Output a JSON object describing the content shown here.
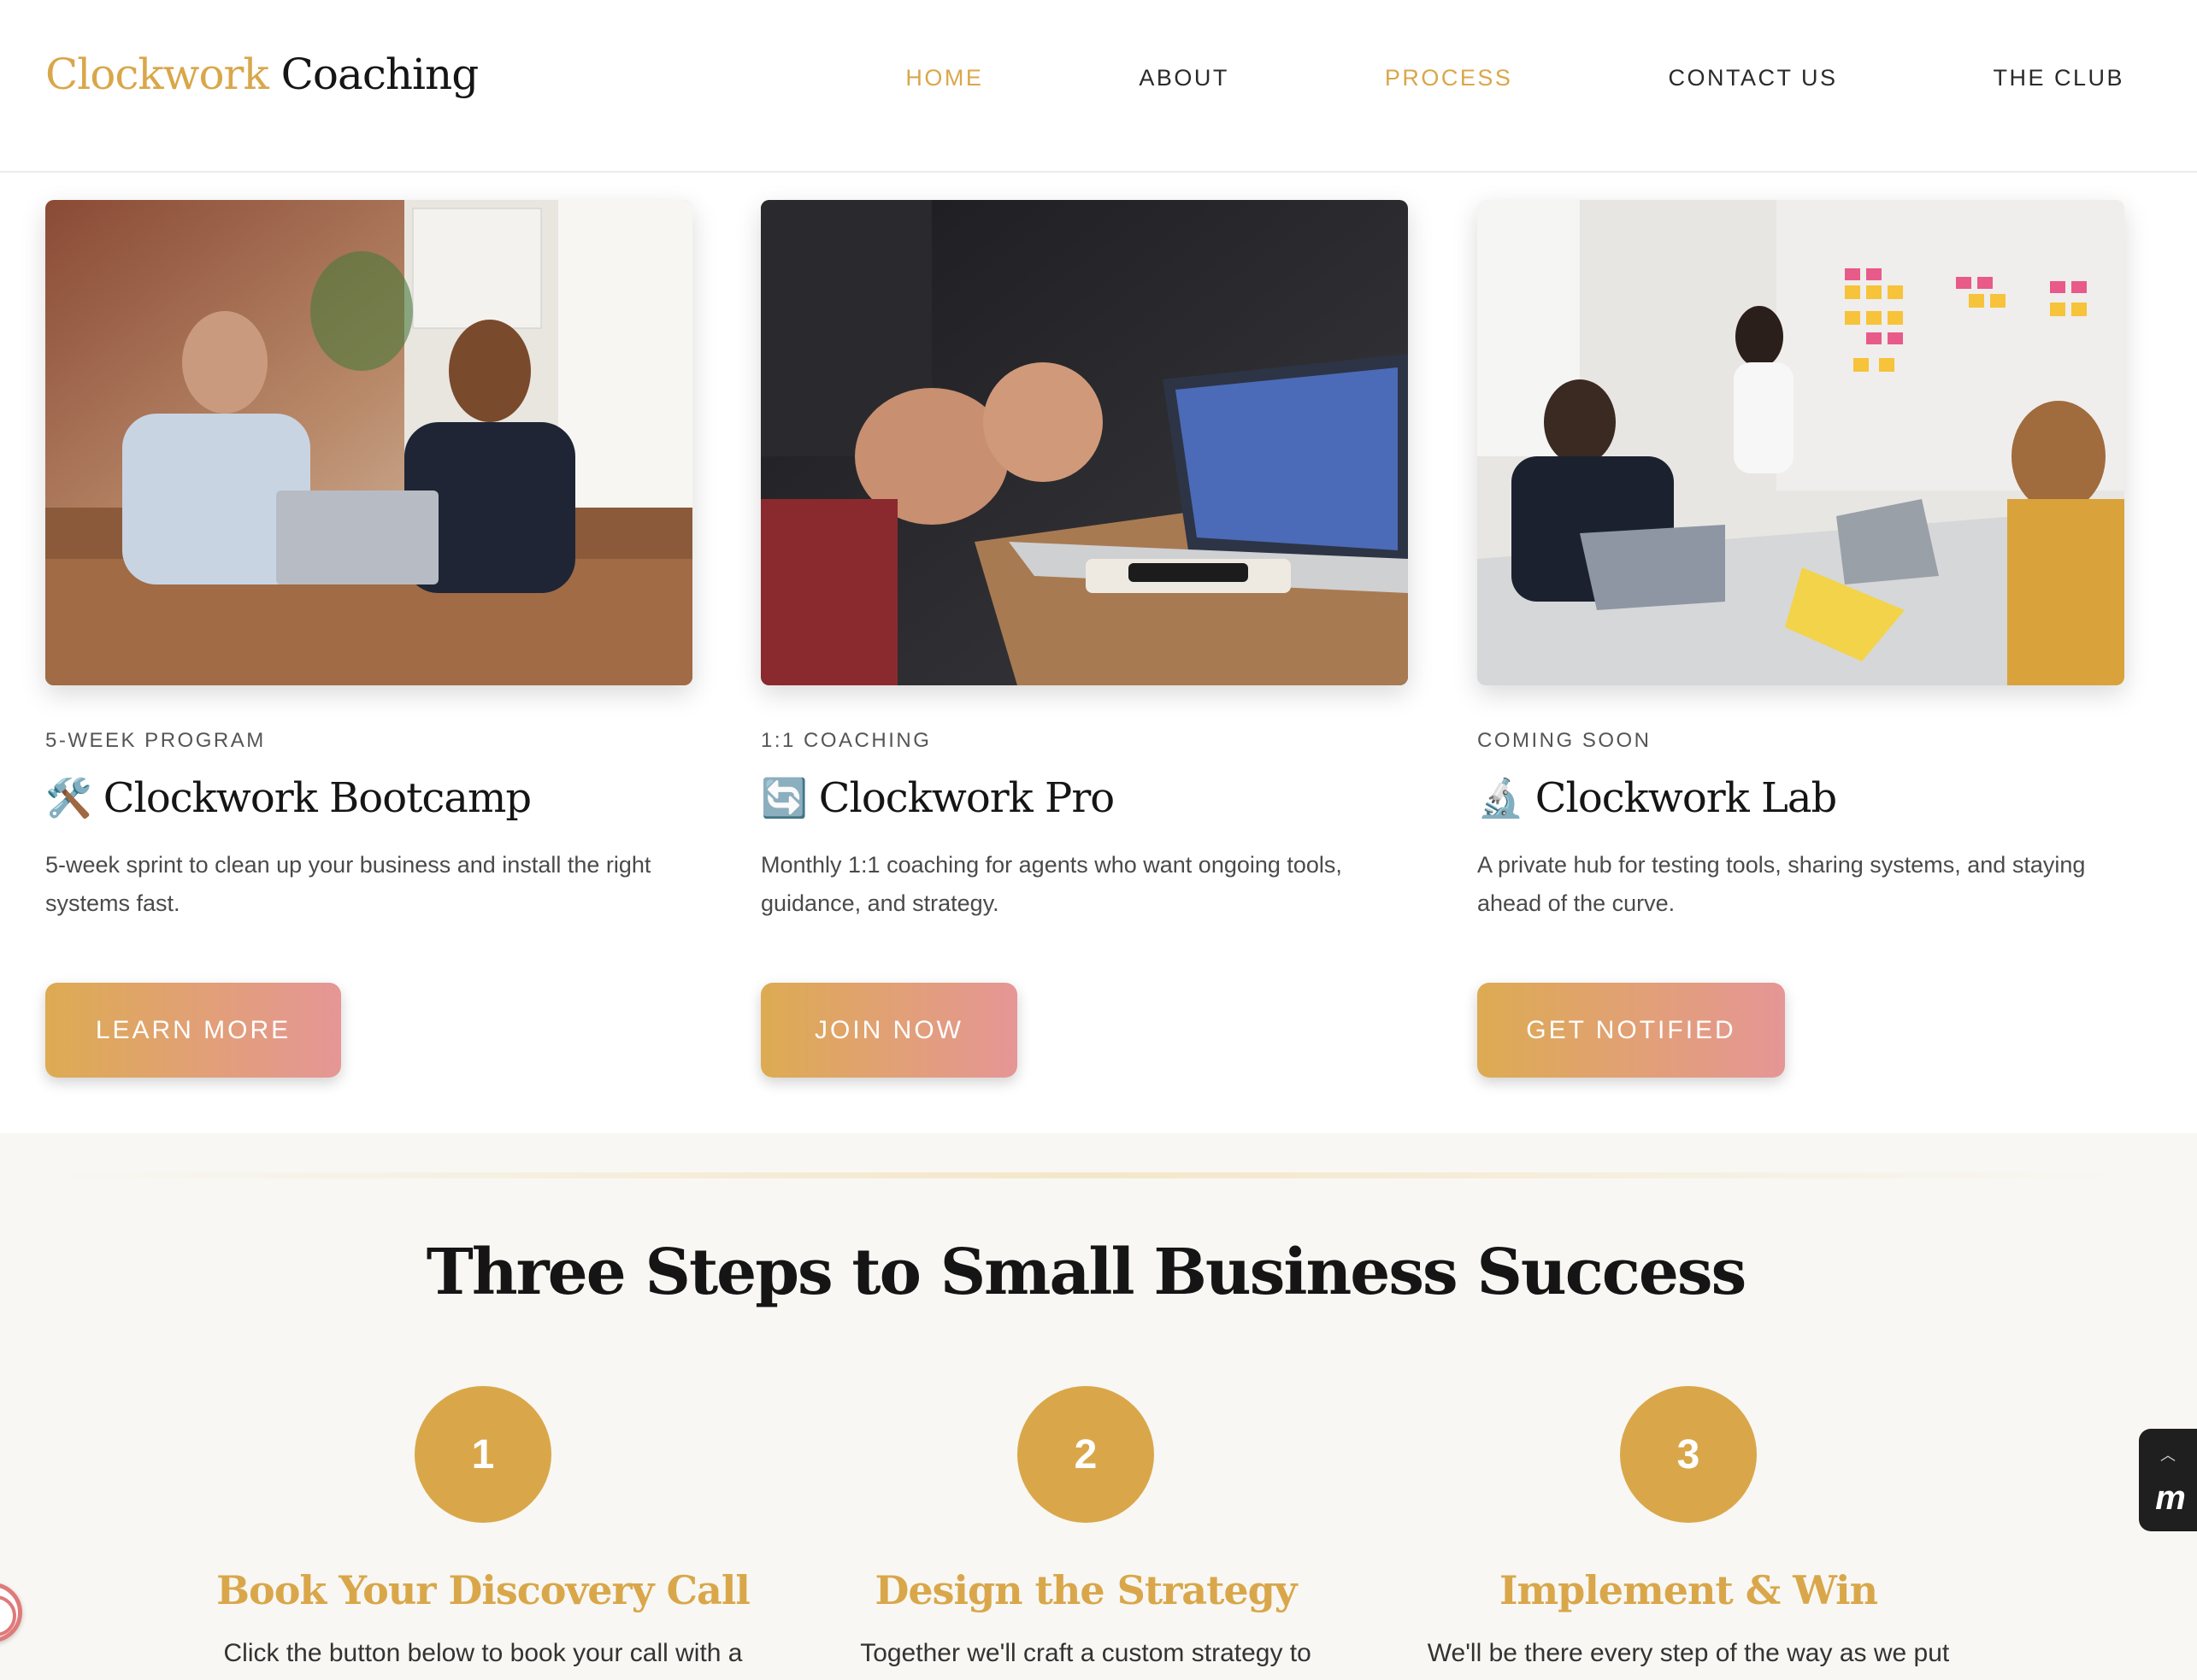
{
  "header": {
    "logo_part1": "Clockwork",
    "logo_part2": "Coaching",
    "nav": [
      {
        "label": "HOME",
        "active": true
      },
      {
        "label": "ABOUT",
        "active": false
      },
      {
        "label": "PROCESS",
        "active": true
      },
      {
        "label": "CONTACT US",
        "active": false
      },
      {
        "label": "THE CLUB",
        "active": false
      }
    ]
  },
  "cards": [
    {
      "eyebrow": "5-WEEK PROGRAM",
      "emoji": "🛠️",
      "title": "Clockwork Bootcamp",
      "description": "5-week sprint to clean up your business and install the right systems fast.",
      "button": "LEARN MORE",
      "image": "two professionals high-fiving at office desk"
    },
    {
      "eyebrow": "1:1 COACHING",
      "emoji": "🔄",
      "title": "Clockwork Pro",
      "description": "Monthly 1:1 coaching for agents who want ongoing tools, guidance, and strategy.",
      "button": "JOIN NOW",
      "image": "hands gesturing over laptop in meeting"
    },
    {
      "eyebrow": "COMING SOON",
      "emoji": "🔬",
      "title": "Clockwork Lab",
      "description": "A private hub for testing tools, sharing systems, and staying ahead of the curve.",
      "button": "GET NOTIFIED",
      "image": "team meeting with sticky notes on whiteboard"
    }
  ],
  "steps_section": {
    "title": "Three Steps to Small Business Success",
    "steps": [
      {
        "number": "1",
        "title": "Book Your Discovery Call",
        "text": "Click the button below to book your call with a"
      },
      {
        "number": "2",
        "title": "Design the Strategy",
        "text": "Together we'll craft a custom strategy to"
      },
      {
        "number": "3",
        "title": "Implement & Win",
        "text": "We'll be there every step of the way as we put"
      }
    ]
  },
  "colors": {
    "accent": "#d9a74a",
    "button_gradient_start": "#ddab52",
    "button_gradient_end": "#e59696",
    "section_bg": "#f8f7f3"
  },
  "icons": {
    "side_widget": "chevron-up-icon",
    "side_widget_logo": "m-logo-icon",
    "left_badge": "accessibility-badge-icon"
  }
}
